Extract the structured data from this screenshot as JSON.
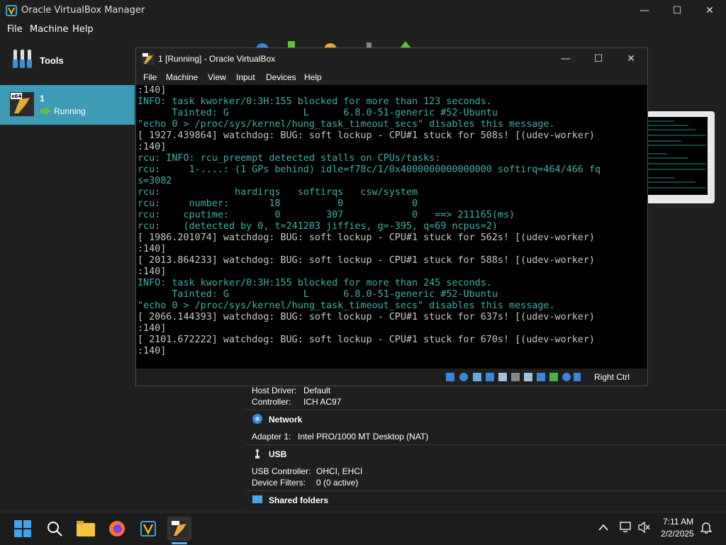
{
  "manager": {
    "title": "Oracle VirtualBox Manager",
    "menu": [
      "File",
      "Machine",
      "Help"
    ],
    "tools_label": "Tools",
    "vm": {
      "name": "1",
      "status": "Running",
      "badge": "x64"
    }
  },
  "details": {
    "audio_host_label": "Host Driver:",
    "audio_host_value": "Default",
    "audio_ctrl_label": "Controller:",
    "audio_ctrl_value": "ICH AC97",
    "network_title": "Network",
    "adapter_label": "Adapter 1:",
    "adapter_value": "Intel PRO/1000 MT Desktop (NAT)",
    "usb_title": "USB",
    "usb_ctrl_label": "USB Controller:",
    "usb_ctrl_value": "OHCI, EHCI",
    "device_filters_label": "Device Filters:",
    "device_filters_value": "0 (0 active)",
    "shared_title": "Shared folders"
  },
  "vmwindow": {
    "title": "1 [Running] - Oracle VirtualBox",
    "menu": [
      "File",
      "Machine",
      "View",
      "Input",
      "Devices",
      "Help"
    ],
    "host_key": "Right Ctrl",
    "console_lines": [
      {
        "text": ":140]",
        "color": "#c8c8c8"
      },
      {
        "text": "INFO: task kworker/0:3H:155 blocked for more than 123 seconds.",
        "color": "#3fb0a8"
      },
      {
        "text": "      Tainted: G             L      6.8.0-51-generic #52-Ubuntu",
        "color": "#3fb0a8"
      },
      {
        "text": "\"echo 0 > /proc/sys/kernel/hung_task_timeout_secs\" disables this message.",
        "color": "#3fb0a8"
      },
      {
        "text": "[ 1927.439864] watchdog: BUG: soft lockup - CPU#1 stuck for 508s! [(udev-worker)",
        "color": "#c8c8c8"
      },
      {
        "text": ":140]",
        "color": "#c8c8c8"
      },
      {
        "text": "rcu: INFO: rcu_preempt detected stalls on CPUs/tasks:",
        "color": "#3fb0a8"
      },
      {
        "text": "rcu:     1-....: (1 GPs behind) idle=f78c/1/0x4000000000000000 softirq=464/466 fq",
        "color": "#3fb0a8"
      },
      {
        "text": "s=3082",
        "color": "#3fb0a8"
      },
      {
        "text": "rcu:             hardirqs   softirqs   csw/system",
        "color": "#3fb0a8"
      },
      {
        "text": "rcu:     number:       18          0            0",
        "color": "#3fb0a8"
      },
      {
        "text": "rcu:    cputime:        0        307            0   ==> 211165(ms)",
        "color": "#3fb0a8"
      },
      {
        "text": "rcu:    (detected by 0, t=241203 jiffies, g=-395, q=69 ncpus=2)",
        "color": "#3fb0a8"
      },
      {
        "text": "[ 1986.201074] watchdog: BUG: soft lockup - CPU#1 stuck for 562s! [(udev-worker)",
        "color": "#c8c8c8"
      },
      {
        "text": ":140]",
        "color": "#c8c8c8"
      },
      {
        "text": "[ 2013.864233] watchdog: BUG: soft lockup - CPU#1 stuck for 588s! [(udev-worker)",
        "color": "#c8c8c8"
      },
      {
        "text": ":140]",
        "color": "#c8c8c8"
      },
      {
        "text": "INFO: task kworker/0:3H:155 blocked for more than 245 seconds.",
        "color": "#3fb0a8"
      },
      {
        "text": "      Tainted: G             L      6.8.0-51-generic #52-Ubuntu",
        "color": "#3fb0a8"
      },
      {
        "text": "\"echo 0 > /proc/sys/kernel/hung_task_timeout_secs\" disables this message.",
        "color": "#3fb0a8"
      },
      {
        "text": "[ 2066.144393] watchdog: BUG: soft lockup - CPU#1 stuck for 637s! [(udev-worker)",
        "color": "#c8c8c8"
      },
      {
        "text": ":140]",
        "color": "#c8c8c8"
      },
      {
        "text": "[ 2101.672222] watchdog: BUG: soft lockup - CPU#1 stuck for 670s! [(udev-worker)",
        "color": "#c8c8c8"
      },
      {
        "text": ":140]",
        "color": "#c8c8c8"
      }
    ]
  },
  "taskbar": {
    "time": "7:11 AM",
    "date": "2/2/2025"
  },
  "colors": {
    "selected_row": "#3d9bb5",
    "console_teal": "#3fb0a8",
    "console_gray": "#c8c8c8"
  }
}
